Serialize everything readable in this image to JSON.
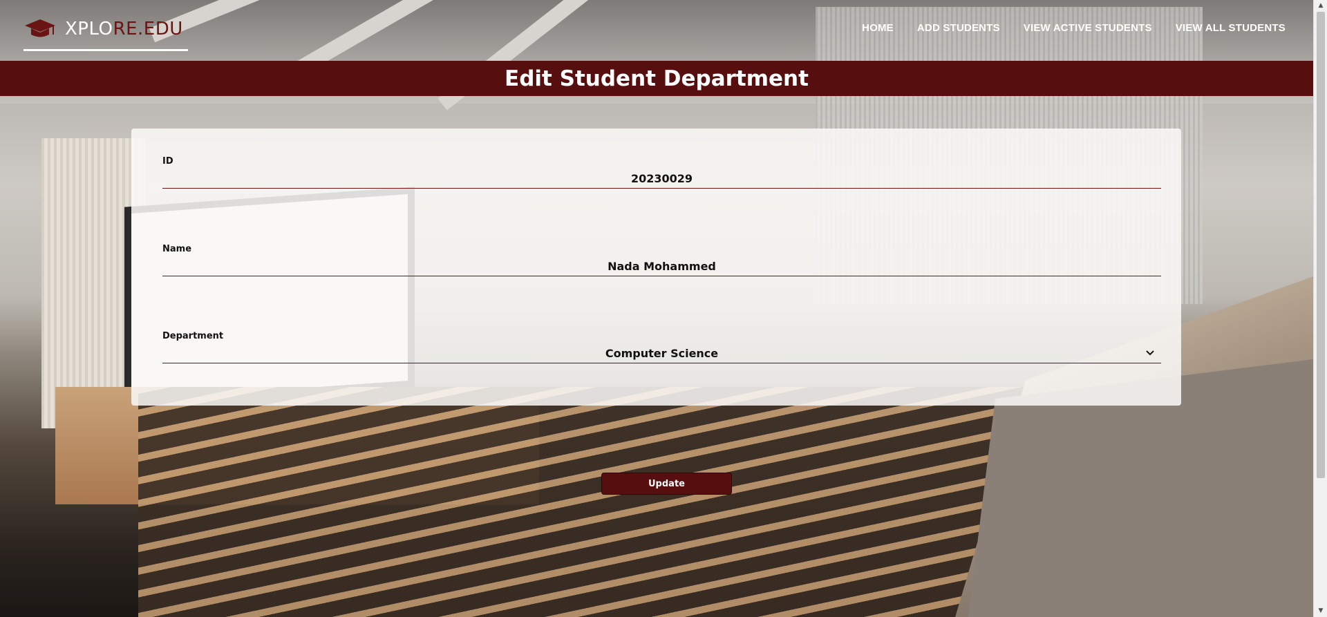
{
  "logo": {
    "text_light": "XPLO",
    "text_dark": "RE.EDU"
  },
  "nav": {
    "items": [
      {
        "label": "HOME"
      },
      {
        "label": "ADD STUDENTS"
      },
      {
        "label": "VIEW ACTIVE STUDENTS"
      },
      {
        "label": "VIEW ALL STUDENTS"
      }
    ]
  },
  "page": {
    "title": "Edit Student Department"
  },
  "form": {
    "id": {
      "label": "ID",
      "value": "20230029"
    },
    "name": {
      "label": "Name",
      "value": "Nada Mohammed"
    },
    "department": {
      "label": "Department",
      "selected": "Computer Science"
    },
    "update_label": "Update"
  },
  "colors": {
    "brand_maroon": "#560e0e",
    "underline": "#6b1414",
    "nav_text": "#ffffff"
  },
  "icons": {
    "logo": "graduation-cap-icon",
    "select": "chevron-down-icon"
  }
}
